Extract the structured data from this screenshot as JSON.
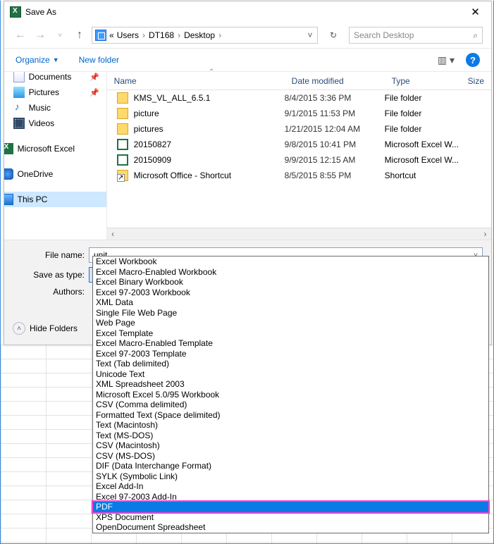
{
  "title": "Save As",
  "breadcrumb": {
    "prefix": "«",
    "parts": [
      "Users",
      "DT168",
      "Desktop"
    ]
  },
  "search": {
    "placeholder": "Search Desktop"
  },
  "toolbar": {
    "organize": "Organize",
    "newfolder": "New folder"
  },
  "sidebar": {
    "items": [
      {
        "label": "Documents",
        "icon": "doc",
        "pinned": true
      },
      {
        "label": "Pictures",
        "icon": "pic",
        "pinned": true
      },
      {
        "label": "Music",
        "icon": "music"
      },
      {
        "label": "Videos",
        "icon": "vid"
      }
    ],
    "apps": [
      {
        "label": "Microsoft Excel",
        "icon": "xl"
      },
      {
        "label": "OneDrive",
        "icon": "cloud"
      },
      {
        "label": "This PC",
        "icon": "pc",
        "selected": true
      }
    ]
  },
  "columns": {
    "name": "Name",
    "date": "Date modified",
    "type": "Type",
    "size": "Size"
  },
  "rows": [
    {
      "icon": "folder",
      "name": "KMS_VL_ALL_6.5.1",
      "date": "8/4/2015 3:36 PM",
      "type": "File folder"
    },
    {
      "icon": "folder",
      "name": "picture",
      "date": "9/1/2015 11:53 PM",
      "type": "File folder"
    },
    {
      "icon": "folder",
      "name": "pictures",
      "date": "1/21/2015 12:04 AM",
      "type": "File folder"
    },
    {
      "icon": "xl",
      "name": "20150827",
      "date": "9/8/2015 10:41 PM",
      "type": "Microsoft Excel W..."
    },
    {
      "icon": "xl",
      "name": "20150909",
      "date": "9/9/2015 12:15 AM",
      "type": "Microsoft Excel W..."
    },
    {
      "icon": "shortcut",
      "name": "Microsoft Office - Shortcut",
      "date": "8/5/2015 8:55 PM",
      "type": "Shortcut"
    }
  ],
  "form": {
    "filename_label": "File name:",
    "filename_value": "unit",
    "type_label": "Save as type:",
    "type_value": "Excel Workbook",
    "authors_label": "Authors:",
    "hide": "Hide Folders"
  },
  "dropdown": {
    "items": [
      "Excel Workbook",
      "Excel Macro-Enabled Workbook",
      "Excel Binary Workbook",
      "Excel 97-2003 Workbook",
      "XML Data",
      "Single File Web Page",
      "Web Page",
      "Excel Template",
      "Excel Macro-Enabled Template",
      "Excel 97-2003 Template",
      "Text (Tab delimited)",
      "Unicode Text",
      "XML Spreadsheet 2003",
      "Microsoft Excel 5.0/95 Workbook",
      "CSV (Comma delimited)",
      "Formatted Text (Space delimited)",
      "Text (Macintosh)",
      "Text (MS-DOS)",
      "CSV (Macintosh)",
      "CSV (MS-DOS)",
      "DIF (Data Interchange Format)",
      "SYLK (Symbolic Link)",
      "Excel Add-In",
      "Excel 97-2003 Add-In",
      "PDF",
      "XPS Document",
      "OpenDocument Spreadsheet"
    ],
    "selected_index": 0,
    "highlighted_index": 24
  }
}
